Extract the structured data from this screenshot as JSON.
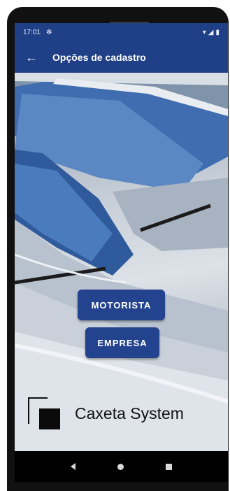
{
  "status_bar": {
    "time": "17:01",
    "settings_icon": "gear-icon",
    "wifi_icon": "wifi-icon",
    "signal_icon": "signal-icon",
    "battery_icon": "battery-icon"
  },
  "app_bar": {
    "back_icon": "arrow-left-icon",
    "title": "Opções de cadastro"
  },
  "buttons": {
    "motorista_label": "MOTORISTA",
    "empresa_label": "EMPRESA"
  },
  "brand": {
    "logo_icon": "caxeta-logo-icon",
    "name": "Caxeta System"
  },
  "nav_bar": {
    "back_icon": "nav-back-icon",
    "home_icon": "nav-home-icon",
    "recent_icon": "nav-recent-icon"
  },
  "colors": {
    "primary": "#1f3f86",
    "button": "#23438f",
    "nav_bar": "#000000"
  }
}
